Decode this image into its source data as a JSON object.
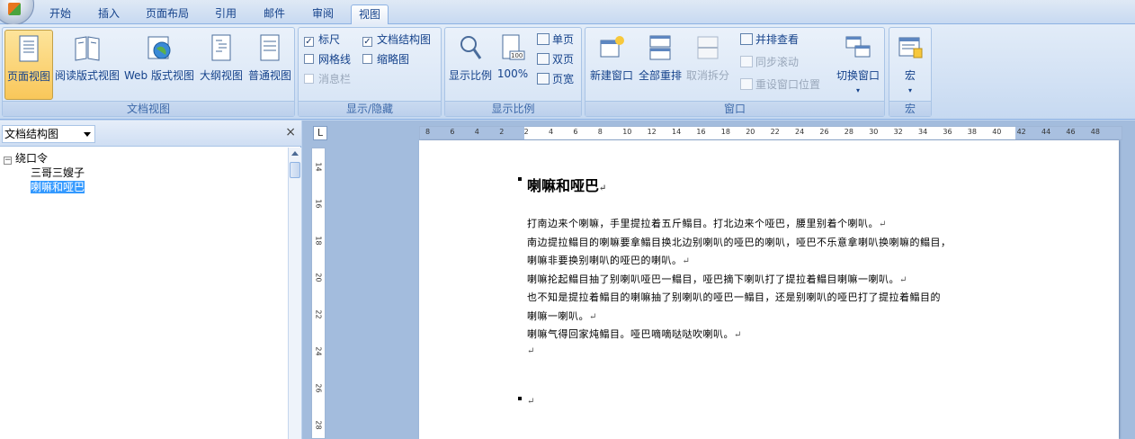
{
  "tabs": [
    {
      "label": "开始",
      "active": false
    },
    {
      "label": "插入",
      "active": false
    },
    {
      "label": "页面布局",
      "active": false
    },
    {
      "label": "引用",
      "active": false
    },
    {
      "label": "邮件",
      "active": false
    },
    {
      "label": "审阅",
      "active": false
    },
    {
      "label": "视图",
      "active": true
    }
  ],
  "ribbon": {
    "doc_views": {
      "label": "文档视图",
      "buttons": [
        "页面视图",
        "阅读版式视图",
        "Web 版式视图",
        "大纲视图",
        "普通视图"
      ]
    },
    "show_hide": {
      "label": "显示/隐藏",
      "ruler": {
        "label": "标尺",
        "checked": true
      },
      "gridlines": {
        "label": "网格线",
        "checked": false
      },
      "message_bar": {
        "label": "消息栏",
        "checked": false
      },
      "doc_map": {
        "label": "文档结构图",
        "checked": true
      },
      "thumbnails": {
        "label": "缩略图",
        "checked": false
      }
    },
    "zoom": {
      "label": "显示比例",
      "zoom_button": "显示比例",
      "percent_button": "100%",
      "one_page": "单页",
      "two_pages": "双页",
      "page_width": "页宽"
    },
    "window": {
      "label": "窗口",
      "new_window": "新建窗口",
      "arrange_all": "全部重排",
      "split": "取消拆分",
      "side_by_side": "并排查看",
      "sync_scroll": "同步滚动",
      "reset_position": "重设窗口位置",
      "switch_windows": "切换窗口"
    },
    "macros": {
      "label": "宏",
      "macros_button": "宏"
    }
  },
  "nav_pane": {
    "select_value": "文档结构图",
    "close": "×",
    "tree": {
      "root": "绕口令",
      "items": [
        "三哥三嫂子",
        "喇嘛和哑巴"
      ],
      "selected_index": 1
    }
  },
  "ruler": {
    "h_ticks": [
      "8",
      "6",
      "4",
      "2",
      "2",
      "4",
      "6",
      "8",
      "10",
      "12",
      "14",
      "16",
      "18",
      "20",
      "22",
      "24",
      "26",
      "28",
      "30",
      "32",
      "34",
      "36",
      "38",
      "40",
      "42",
      "44",
      "46",
      "48"
    ],
    "v_ticks": [
      "14",
      "16",
      "18",
      "20",
      "22",
      "24",
      "26",
      "28"
    ],
    "tab_icon": "L"
  },
  "document": {
    "title": "喇嘛和哑巴",
    "paragraphs": [
      "打南边来个喇嘛，手里提拉着五斤鳎目。打北边来个哑巴，腰里别着个喇叭。",
      "南边提拉鳎目的喇嘛要拿鳎目换北边别喇叭的哑巴的喇叭，哑巴不乐意拿喇叭换喇嘛的鳎目，",
      "喇嘛非要换别喇叭的哑巴的喇叭。",
      "喇嘛抡起鳎目抽了别喇叭哑巴一鳎目，哑巴摘下喇叭打了提拉着鳎目喇嘛一喇叭。",
      "也不知是提拉着鳎目的喇嘛抽了别喇叭的哑巴一鳎目，还是别喇叭的哑巴打了提拉着鳎目的",
      "喇嘛一喇叭。",
      "喇嘛气得回家炖鳎目。哑巴嘀嘀哒哒吹喇叭。"
    ],
    "para_mark": "↵"
  }
}
